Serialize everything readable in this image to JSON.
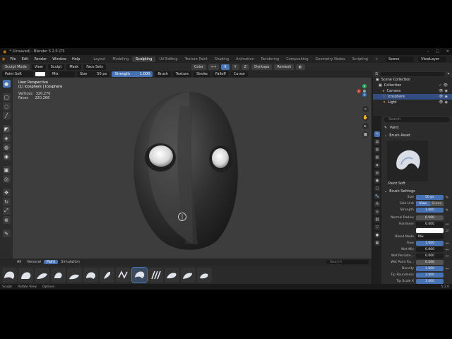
{
  "window": {
    "title": "* (Unsaved) - Blender 5.2.0 LTS",
    "controls": [
      "–",
      "□",
      "✕"
    ]
  },
  "menu": [
    "File",
    "Edit",
    "Render",
    "Window",
    "Help"
  ],
  "workspaces": [
    "Layout",
    "Modeling",
    "Sculpting",
    "UV Editing",
    "Texture Paint",
    "Shading",
    "Animation",
    "Rendering",
    "Compositing",
    "Geometry Nodes",
    "Scripting"
  ],
  "active_workspace": "Sculpting",
  "add_tab": "+",
  "scene": "Scene",
  "view_layer": "ViewLayer",
  "editor_header": {
    "mode": "Sculpt Mode",
    "menus": [
      "View",
      "Sculpt",
      "Mask",
      "Face Sets"
    ],
    "color_label": "Color",
    "dyntopo": "Dyntopo",
    "remesh": "Remesh"
  },
  "tool_header": {
    "brush": "Paint Soft",
    "blend": "Mix",
    "size_label": "Size",
    "size_value": "50 px",
    "strength_label": "Strength",
    "strength_value": "1.000",
    "menus": [
      "Brush",
      "Texture",
      "Stroke",
      "Falloff",
      "Cursor"
    ]
  },
  "viewport": {
    "view_name": "User Perspective",
    "object": "(1) Icosphere | Icosphere",
    "vertices_label": "Vertices",
    "vertices_value": "320,270",
    "faces_label": "Faces",
    "faces_value": "220,268"
  },
  "gizmo": {
    "x": "X",
    "y": "Y",
    "z": "Z"
  },
  "asset_tabs": [
    "All",
    "General",
    "Paint",
    "Simulation"
  ],
  "active_asset_tab": "Paint",
  "asset_search_placeholder": "Search",
  "statusbar": {
    "select": "Sculpt",
    "rotate": "Rotate View",
    "options": "Options",
    "version": "5.2.0"
  },
  "outliner": {
    "search_placeholder": "",
    "rows": [
      {
        "name": "Scene Collection"
      },
      {
        "name": "Collection"
      },
      {
        "name": "Camera"
      },
      {
        "name": "Icosphere"
      },
      {
        "name": "Light"
      }
    ]
  },
  "properties": {
    "search_placeholder": "Search",
    "header": "Paint",
    "brush_asset_title": "Brush Asset",
    "brush_name": "Paint Soft",
    "brush_settings_title": "Brush Settings",
    "rows": {
      "size": {
        "label": "Size",
        "value": "50 px"
      },
      "size_unit": {
        "label": "Size Unit",
        "options": [
          "View",
          "Scene"
        ],
        "selected": "View"
      },
      "strength": {
        "label": "Strength",
        "value": "1.000"
      },
      "normal_radius": {
        "label": "Normal Radius",
        "value": "0.500"
      },
      "hardness": {
        "label": "Hardness",
        "value": "0.000"
      },
      "blend_mode": {
        "label": "Blend Mode",
        "value": "Mix"
      },
      "flow": {
        "label": "Flow",
        "value": "1.000"
      },
      "wet_mix": {
        "label": "Wet Mix",
        "value": "0.000"
      },
      "wet_persist": {
        "label": "Wet Persiste...",
        "value": "0.000"
      },
      "wet_paint_radius": {
        "label": "Wet Paint Ra...",
        "value": "0.500"
      },
      "density": {
        "label": "Density",
        "value": "1.000"
      },
      "tip_roundness": {
        "label": "Tip Roundness",
        "value": "1.000"
      },
      "tip_scale_x": {
        "label": "Tip Scale X",
        "value": "1.000"
      }
    }
  },
  "colors": {
    "accent": "#4772b3",
    "viewport_bg": "#3d3d3d",
    "panel": "#2c2c2c"
  }
}
